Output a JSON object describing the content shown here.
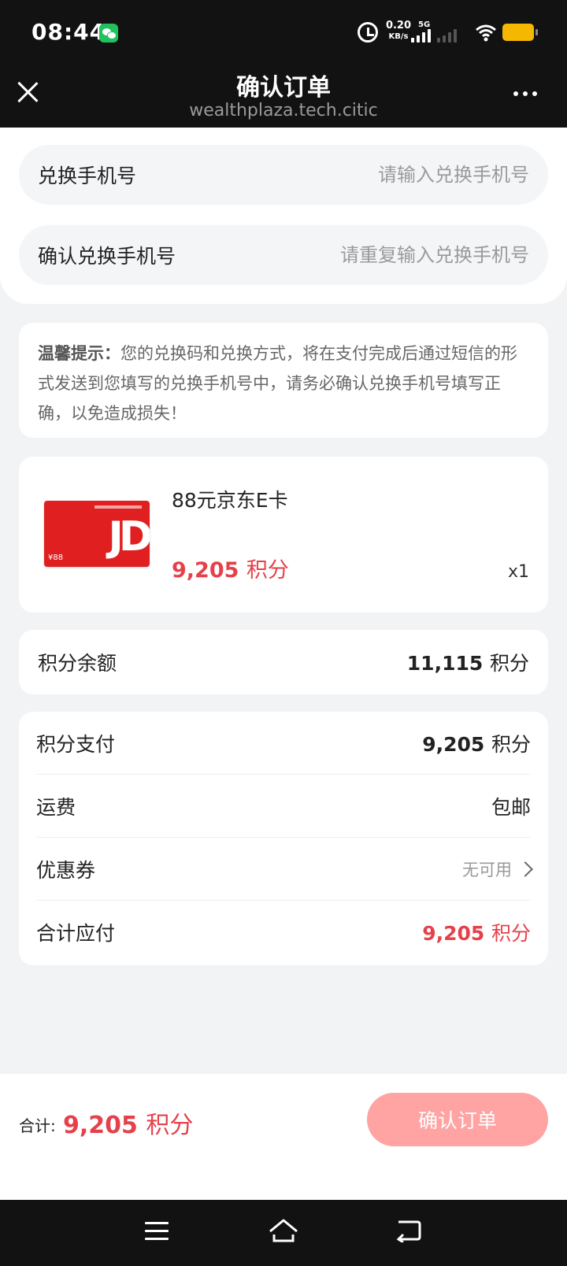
{
  "status_bar": {
    "time": "08:44",
    "net_speed": "0.20",
    "net_unit": "KB/s",
    "network": "5G",
    "battery_color": "#f5b700"
  },
  "title_bar": {
    "title": "确认订单",
    "subtitle": "wealthplaza.tech.citic"
  },
  "form": {
    "phone_label": "兑换手机号",
    "phone_placeholder": "请输入兑换手机号",
    "confirm_label": "确认兑换手机号",
    "confirm_placeholder": "请重复输入兑换手机号"
  },
  "tip": {
    "label": "温馨提示：",
    "text": "您的兑换码和兑换方式，将在支付完成后通过短信的形式发送到您填写的兑换手机号中，请务必确认兑换手机号填写正确，以免造成损失！"
  },
  "product": {
    "image_text": "JD",
    "image_value": "¥88",
    "name": "88元京东E卡",
    "price": "9,205",
    "unit": "积分",
    "quantity": "x1"
  },
  "balance": {
    "label": "积分余额",
    "value": "11,115",
    "unit": "积分"
  },
  "summary": {
    "points_label": "积分支付",
    "points_value": "9,205",
    "shipping_label": "运费",
    "shipping_value": "包邮",
    "coupon_label": "优惠券",
    "coupon_value": "无可用",
    "total_label": "合计应付",
    "total_value": "9,205",
    "unit": "积分"
  },
  "footer": {
    "total_label": "合计:",
    "total_value": "9,205",
    "unit": "积分",
    "confirm_button": "确认订单"
  },
  "colors": {
    "accent": "#e5414a",
    "button_disabled": "#ffa3a3",
    "dark_bar": "#121212"
  }
}
